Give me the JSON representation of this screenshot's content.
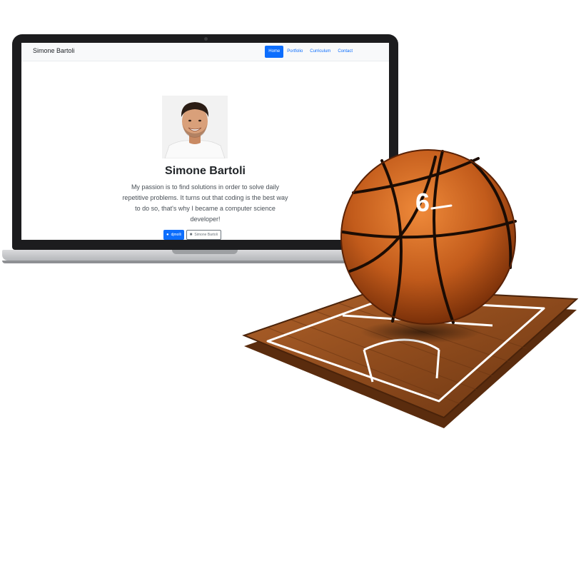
{
  "laptop_site": {
    "brand": "Simone Bartoli",
    "nav": [
      {
        "label": "Home",
        "active": true
      },
      {
        "label": "Portfolio",
        "active": false
      },
      {
        "label": "Curriculum",
        "active": false
      },
      {
        "label": "Contact",
        "active": false
      }
    ],
    "hero": {
      "name": "Simone Bartoli",
      "text": "My passion is to find solutions in order to solve daily repetitive problems. It turns out that coding is the best way to do so, that's why I became a computer science developer!"
    },
    "buttons": [
      {
        "label": "djmolli",
        "icon": "github-icon",
        "style": "primary"
      },
      {
        "label": "Simone Bartoli",
        "icon": "linkedin-icon",
        "style": "outline"
      }
    ]
  },
  "basketball": {
    "number": "6"
  },
  "colors": {
    "accent": "#0d6efd",
    "ball": "#d2691e",
    "court_wood": "#8b4513"
  }
}
